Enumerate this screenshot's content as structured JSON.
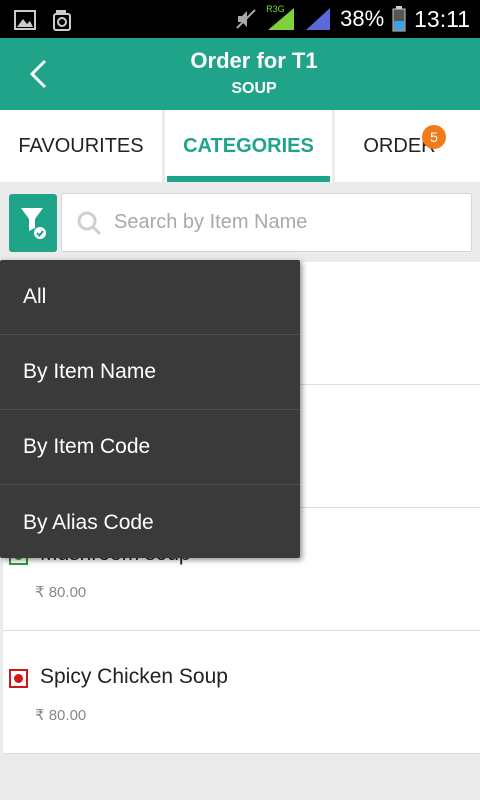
{
  "status_bar": {
    "network_label": "R3G",
    "battery": "38%",
    "time": "13:11"
  },
  "app_bar": {
    "title": "Order for T1",
    "subtitle": "SOUP"
  },
  "tabs": [
    {
      "label": "FAVOURITES",
      "active": false
    },
    {
      "label": "CATEGORIES",
      "active": true
    },
    {
      "label": "ORDER",
      "active": false,
      "badge": "5"
    }
  ],
  "search": {
    "placeholder": "Search by Item Name",
    "value": ""
  },
  "filter_menu": {
    "options": [
      "All",
      "By Item Name",
      "By Item Code",
      "By Alias Code"
    ]
  },
  "items": [
    {
      "name": "",
      "price": "",
      "type": "veg"
    },
    {
      "name": "",
      "price": "",
      "type": "veg"
    },
    {
      "name": "Mushroom soup",
      "price": "₹ 80.00",
      "type": "veg"
    },
    {
      "name": "Spicy Chicken Soup",
      "price": "₹ 80.00",
      "type": "non-veg"
    }
  ],
  "colors": {
    "accent": "#1fa48a",
    "badge": "#f07b1a",
    "veg": "#2e9a3a",
    "non_veg": "#d01818",
    "menu_bg": "#3a3a3a"
  }
}
